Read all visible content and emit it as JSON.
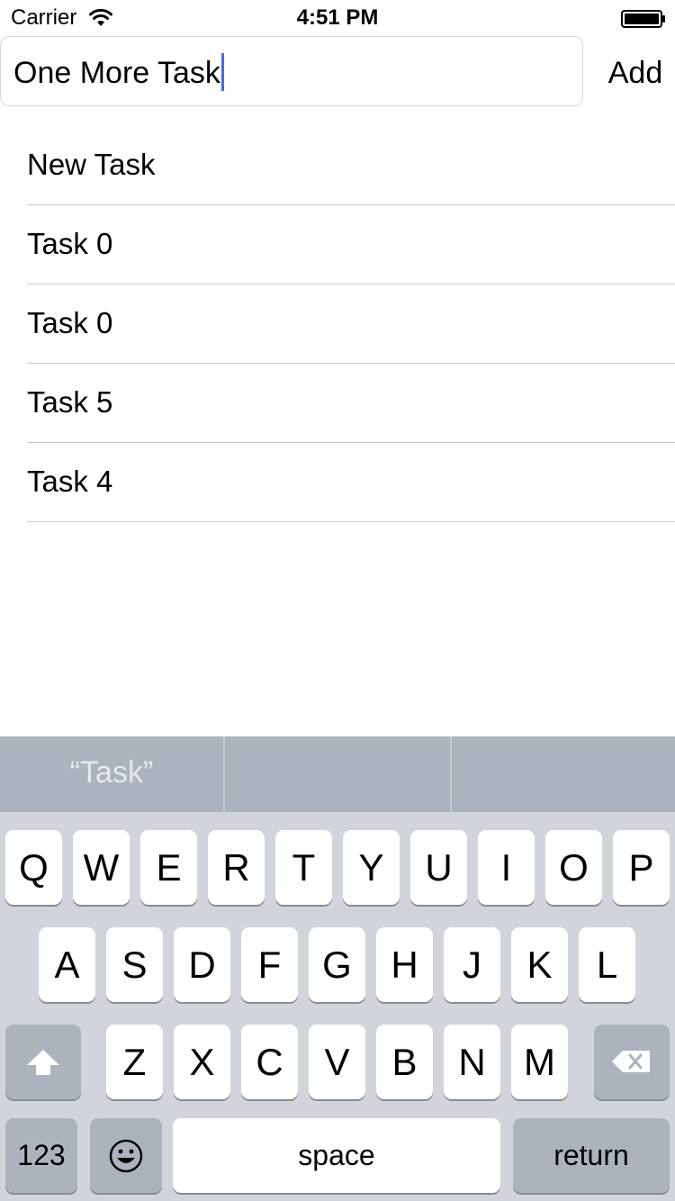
{
  "status_bar": {
    "carrier": "Carrier",
    "time": "4:51 PM",
    "wifi_icon": "wifi-icon",
    "battery_icon": "battery-icon"
  },
  "input": {
    "value": "One More Task",
    "placeholder": ""
  },
  "add_button": {
    "label": "Add"
  },
  "tasks": [
    {
      "label": "New Task"
    },
    {
      "label": "Task 0"
    },
    {
      "label": "Task 0"
    },
    {
      "label": "Task 5"
    },
    {
      "label": "Task 4"
    }
  ],
  "keyboard": {
    "suggestions": [
      "“Task”",
      "",
      ""
    ],
    "row1": [
      "Q",
      "W",
      "E",
      "R",
      "T",
      "Y",
      "U",
      "I",
      "O",
      "P"
    ],
    "row2": [
      "A",
      "S",
      "D",
      "F",
      "G",
      "H",
      "J",
      "K",
      "L"
    ],
    "row3": [
      "Z",
      "X",
      "C",
      "V",
      "B",
      "N",
      "M"
    ],
    "shift_icon": "shift-icon",
    "delete_icon": "delete-icon",
    "numbers_label": "123",
    "emoji_icon": "emoji-icon",
    "space_label": "space",
    "return_label": "return"
  },
  "colors": {
    "caret": "#3d6cf2",
    "keyboard_bg": "#d1d5db",
    "suggestion_bg": "#acb3be",
    "function_key": "#acb3bd"
  }
}
